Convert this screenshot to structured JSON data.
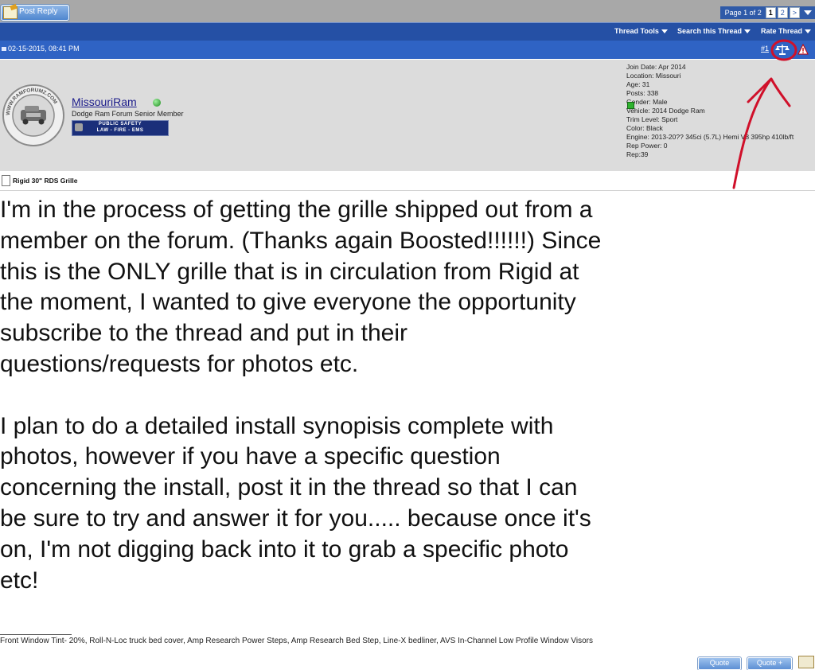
{
  "toolbar": {
    "post_reply": "Post Reply"
  },
  "pagination": {
    "label": "Page 1 of 2",
    "pages": [
      "1",
      "2"
    ],
    "next": ">"
  },
  "thread_tools": {
    "thread_tools": "Thread Tools",
    "search": "Search this Thread",
    "rate": "Rate Thread"
  },
  "post": {
    "date": "02-15-2015, 08:41 PM",
    "number": "#1",
    "title": "Rigid 30\" RDS Grille",
    "body_p1": "I'm in the process of getting the grille shipped out from a member on the forum. (Thanks again Boosted!!!!!!) Since this is the ONLY grille that is in circulation from Rigid at the moment, I wanted to give everyone the opportunity subscribe to the thread and put in their questions/requests for photos etc.",
    "body_p2": "I plan to do a detailed install synopisis complete with photos, however if you have a specific question concerning the install, post it in the thread so that I can be sure to try and answer it for you..... because once it's on, I'm not digging back into it to grab a specific photo etc!",
    "signature": "Front Window Tint- 20%, Roll-N-Loc truck bed cover, Amp Research Power Steps, Amp Research Bed Step, Line-X bedliner, AVS In-Channel Low Profile Window Visors"
  },
  "user": {
    "name": "MissouriRam",
    "title": "Dodge Ram Forum Senior Member",
    "badge_line1": "PUBLIC SAFETY",
    "badge_line2": "LAW - FIRE - EMS",
    "avatar_text": "WWW.RAMFORUMZ.COM",
    "stats": [
      "Join Date: Apr 2014",
      "Location: Missouri",
      "Age: 31",
      "Posts: 338",
      "Gender: Male",
      "Vehicle: 2014 Dodge Ram",
      "Trim Level: Sport",
      "Color: Black",
      "Engine: 2013-20?? 345ci (5.7L) Hemi V8 395hp 410lb/ft",
      "Rep Power: 0",
      "Rep:39"
    ]
  },
  "actions": {
    "quote": "Quote",
    "multi_quote": "Quote +"
  },
  "colors": {
    "header_blue": "#2550a5",
    "date_blue": "#2f63c4",
    "panel_gray": "#dcdcdc",
    "annotation_red": "#d0102a",
    "online_green": "#1c8a1c"
  },
  "icons": [
    "post-reply-icon",
    "reputation-scale-icon",
    "report-warning-icon",
    "online-status-icon",
    "document-icon",
    "quick-reply-icon"
  ]
}
